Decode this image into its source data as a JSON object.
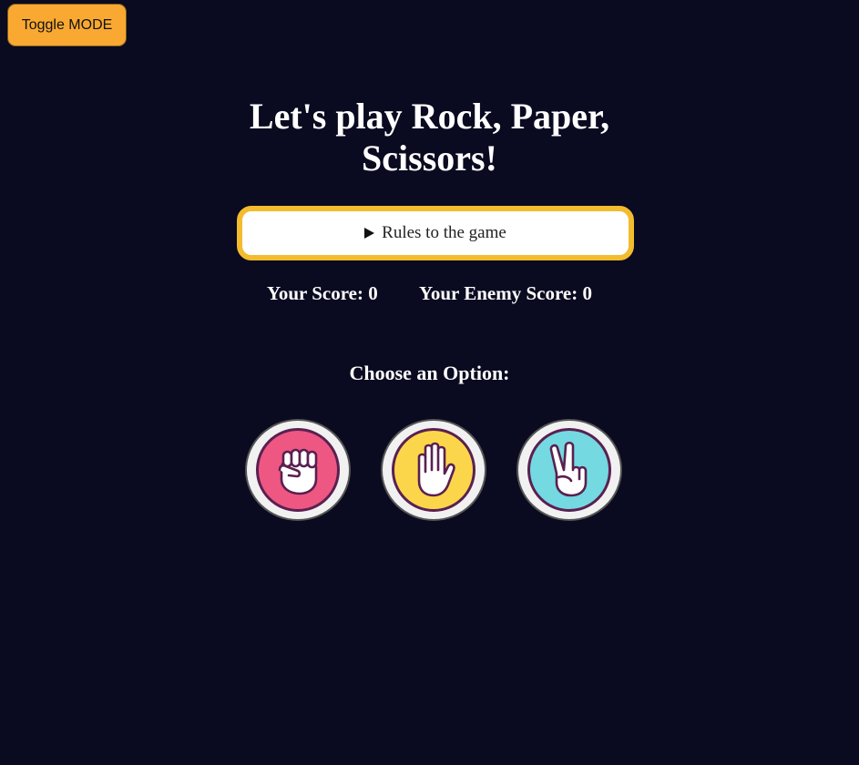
{
  "toggle": {
    "label": "Toggle MODE"
  },
  "title": "Let's play Rock, Paper, Scissors!",
  "rules": {
    "label": "Rules to the game"
  },
  "scores": {
    "your_label": "Your Score:",
    "your_value": "0",
    "enemy_label": "Your Enemy Score:",
    "enemy_value": "0"
  },
  "choose_label": "Choose an Option:",
  "options": [
    {
      "name": "rock",
      "icon": "fist-icon",
      "color": "#ee5782"
    },
    {
      "name": "paper",
      "icon": "open-hand-icon",
      "color": "#fcd64a"
    },
    {
      "name": "scissors",
      "icon": "peace-hand-icon",
      "color": "#74d9e1"
    }
  ],
  "colors": {
    "background": "#0a0a20",
    "accent": "#f9a932",
    "rules_border": "#f3bb2e"
  }
}
